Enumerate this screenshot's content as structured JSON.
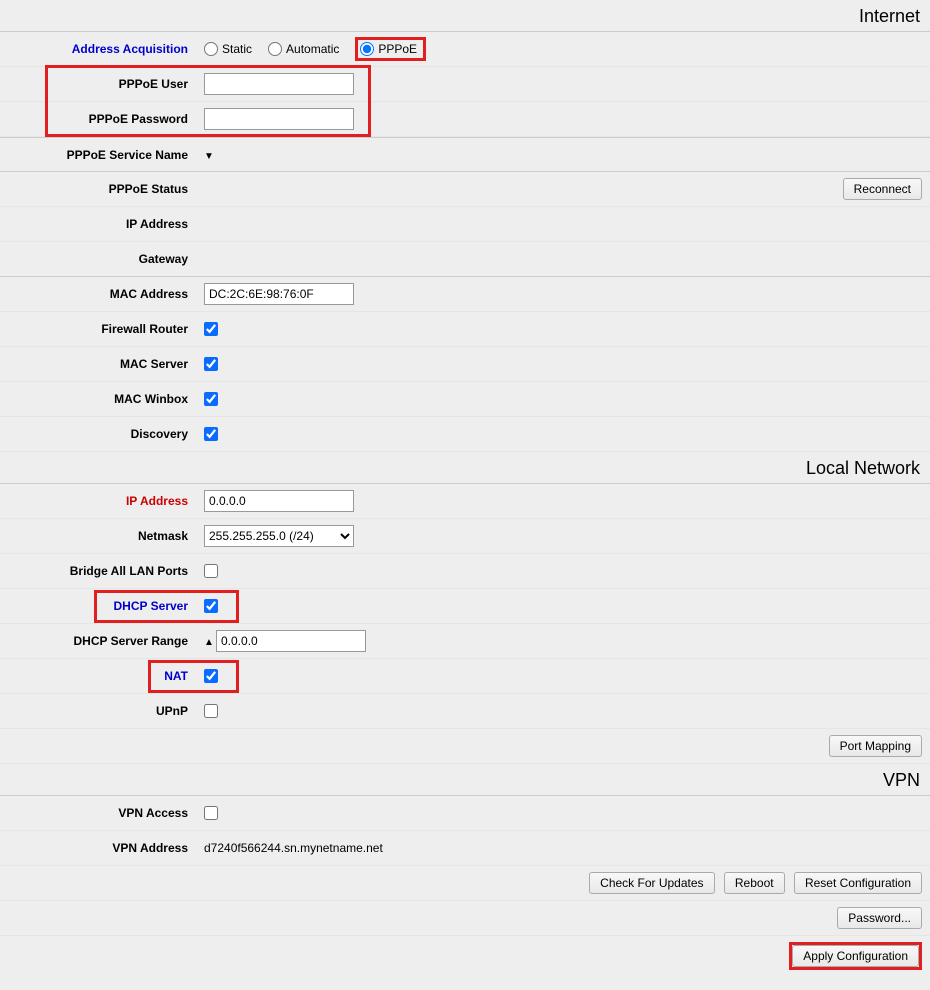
{
  "sections": {
    "internet": "Internet",
    "local": "Local Network",
    "vpn": "VPN"
  },
  "internet": {
    "addressAcquisition": {
      "label": "Address Acquisition",
      "options": {
        "static": "Static",
        "automatic": "Automatic",
        "pppoe": "PPPoE"
      },
      "selected": "pppoe"
    },
    "pppoeUser": {
      "label": "PPPoE User",
      "value": ""
    },
    "pppoePassword": {
      "label": "PPPoE Password",
      "value": ""
    },
    "pppoeServiceName": {
      "label": "PPPoE Service Name"
    },
    "pppoeStatus": {
      "label": "PPPoE Status"
    },
    "reconnect": "Reconnect",
    "ipAddress": {
      "label": "IP Address"
    },
    "gateway": {
      "label": "Gateway"
    },
    "macAddress": {
      "label": "MAC Address",
      "value": "DC:2C:6E:98:76:0F"
    },
    "firewallRouter": {
      "label": "Firewall Router",
      "checked": true
    },
    "macServer": {
      "label": "MAC Server",
      "checked": true
    },
    "macWinbox": {
      "label": "MAC Winbox",
      "checked": true
    },
    "discovery": {
      "label": "Discovery",
      "checked": true
    }
  },
  "local": {
    "ipAddress": {
      "label": "IP Address",
      "value": "0.0.0.0"
    },
    "netmask": {
      "label": "Netmask",
      "value": "255.255.255.0 (/24)"
    },
    "bridgeAll": {
      "label": "Bridge All LAN Ports",
      "checked": false
    },
    "dhcpServer": {
      "label": "DHCP Server",
      "checked": true
    },
    "dhcpRange": {
      "label": "DHCP Server Range",
      "value": "0.0.0.0"
    },
    "nat": {
      "label": "NAT",
      "checked": true
    },
    "upnp": {
      "label": "UPnP",
      "checked": false
    },
    "portMapping": "Port Mapping"
  },
  "vpn": {
    "access": {
      "label": "VPN Access",
      "checked": false
    },
    "address": {
      "label": "VPN Address",
      "value": "d7240f566244.sn.mynetname.net"
    }
  },
  "buttons": {
    "checkUpdates": "Check For Updates",
    "reboot": "Reboot",
    "resetConfig": "Reset Configuration",
    "password": "Password...",
    "applyConfig": "Apply Configuration"
  }
}
